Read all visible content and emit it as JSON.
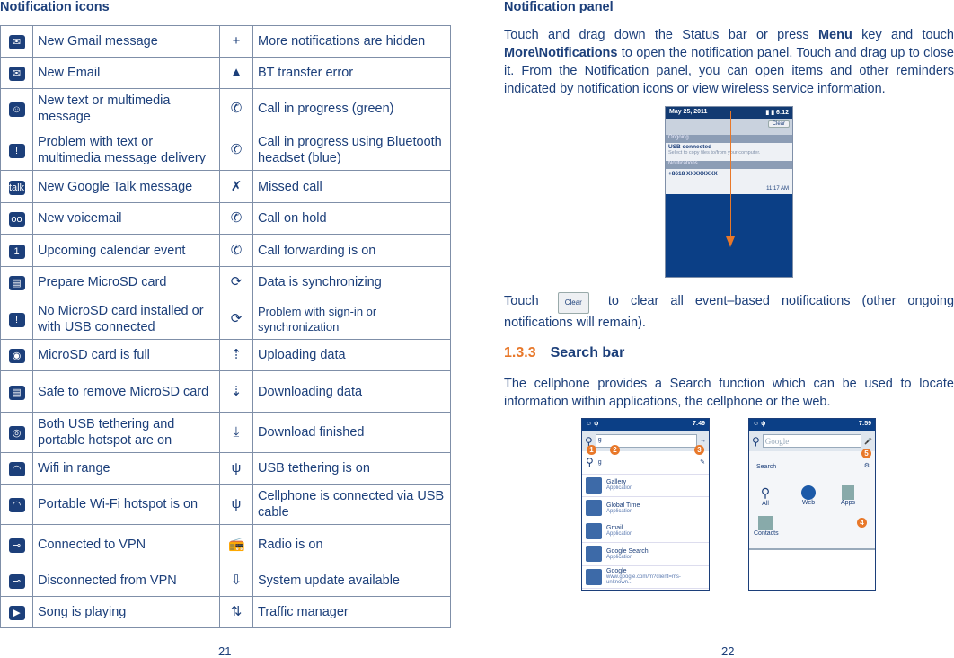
{
  "left": {
    "title": "Notification icons",
    "page_number": "21",
    "rows": [
      {
        "l_icon": "gmail-icon",
        "l_glyph": "✉",
        "l": "New Gmail message",
        "r_icon": "more-hidden-icon",
        "r_glyph": "+",
        "r": "More notifications are hidden"
      },
      {
        "l_icon": "email-icon",
        "l_glyph": "✉",
        "l": "New Email",
        "r_icon": "warning-icon",
        "r_glyph": "▲",
        "r": "BT transfer error"
      },
      {
        "l_icon": "sms-icon",
        "l_glyph": "☺",
        "l": "New text or multimedia message",
        "r_icon": "call-green-icon",
        "r_glyph": "✆",
        "r": "Call in progress (green)"
      },
      {
        "l_icon": "sms-error-icon",
        "l_glyph": "!",
        "l": "Problem with text or multimedia message delivery",
        "r_icon": "call-bluetooth-icon",
        "r_glyph": "✆",
        "r": "Call in progress using Bluetooth headset (blue)"
      },
      {
        "l_icon": "talk-icon",
        "l_glyph": "talk",
        "l": "New Google Talk message",
        "r_icon": "missed-call-icon",
        "r_glyph": "✗",
        "r": "Missed call"
      },
      {
        "l_icon": "voicemail-icon",
        "l_glyph": "oo",
        "l": "New voicemail",
        "r_icon": "call-hold-icon",
        "r_glyph": "✆",
        "r": "Call on hold"
      },
      {
        "l_icon": "calendar-icon",
        "l_glyph": "1",
        "l": "Upcoming calendar event",
        "r_icon": "call-forward-icon",
        "r_glyph": "✆",
        "r": "Call forwarding is on"
      },
      {
        "l_icon": "sdcard-prepare-icon",
        "l_glyph": "▤",
        "l": "Prepare MicroSD card",
        "r_icon": "sync-icon",
        "r_glyph": "⟳",
        "r": "Data is synchronizing"
      },
      {
        "l_icon": "sdcard-missing-icon",
        "l_glyph": "!",
        "l": "No MicroSD card installed or with USB connected",
        "r_icon": "sync-error-icon",
        "r_glyph": "⟳",
        "r": "Problem with sign-in or synchronization",
        "r_small": true
      },
      {
        "l_icon": "sdcard-full-icon",
        "l_glyph": "◉",
        "l": "MicroSD card is full",
        "r_icon": "upload-icon",
        "r_glyph": "⇡",
        "r": "Uploading data"
      },
      {
        "l_icon": "sdcard-safe-icon",
        "l_glyph": "▤",
        "l": "Safe to remove MicroSD card",
        "r_icon": "download-icon",
        "r_glyph": "⇣",
        "r": "Downloading data"
      },
      {
        "l_icon": "tether-hotspot-icon",
        "l_glyph": "◎",
        "l": "Both USB tethering and portable hotspot are on",
        "r_icon": "download-done-icon",
        "r_glyph": "⤓",
        "r": "Download finished"
      },
      {
        "l_icon": "wifi-icon",
        "l_glyph": "◠",
        "l": "Wifi in range",
        "r_icon": "usb-tether-icon",
        "r_glyph": "ψ",
        "r": "USB tethering is on"
      },
      {
        "l_icon": "hotspot-icon",
        "l_glyph": "◠",
        "l": "Portable Wi-Fi hotspot is on",
        "r_icon": "usb-icon",
        "r_glyph": "ψ",
        "r": "Cellphone is connected via USB cable"
      },
      {
        "l_icon": "vpn-connected-icon",
        "l_glyph": "⊸",
        "l": "Connected to VPN",
        "r_icon": "radio-icon",
        "r_glyph": "📻",
        "r": "Radio is on"
      },
      {
        "l_icon": "vpn-disconnected-icon",
        "l_glyph": "⊸",
        "l": " Disconnected from VPN",
        "r_icon": "system-update-icon",
        "r_glyph": "⇩",
        "r": "System update available"
      },
      {
        "l_icon": "song-playing-icon",
        "l_glyph": "▶",
        "l": "Song is playing",
        "r_icon": "traffic-manager-icon",
        "r_glyph": "⇅",
        "r": "Traffic manager"
      }
    ]
  },
  "right": {
    "title": "Notification panel",
    "page_number": "22",
    "p1_a": "Touch and drag down the Status bar or press ",
    "p1_menu": "Menu",
    "p1_b": " key and touch ",
    "p1_more": "More\\Notifications",
    "p1_c": " to open the notification panel. Touch and drag up to close it. From the Notification panel, you can open items and other reminders indicated by notification icons or view wireless service information.",
    "p2_a": "Touch",
    "p2_btn": "Clear",
    "p2_b": "to clear all event–based notifications (other ongoing notifications will remain).",
    "section_num": "1.3.3",
    "section_title": "Search bar",
    "p3": "The cellphone provides a Search function which can be used to locate information within applications, the cellphone or the web.",
    "panel_shot": {
      "date": "May 25, 2011",
      "time": "6:12",
      "clear": "Clear",
      "ongoing": "Ongoing",
      "usb_title": "USB connected",
      "usb_sub": "Select to copy files to/from your computer.",
      "notifications": "Notifications",
      "msg": "+8618 XXXXXXXX",
      "msg_time": "11:17 AM"
    },
    "search_shot1": {
      "time": "7:49",
      "query": "g",
      "suggest": "g",
      "items": [
        {
          "t": "Gallery",
          "s": "Application"
        },
        {
          "t": "Global Time",
          "s": "Application"
        },
        {
          "t": "Gmail",
          "s": "Application"
        },
        {
          "t": "Google Search",
          "s": "Application"
        },
        {
          "t": "Google",
          "s": "www.google.com/m?client=ms-unknown..."
        }
      ],
      "badges": [
        "1",
        "2",
        "3"
      ]
    },
    "search_shot2": {
      "time": "7:59",
      "placeholder": "Google",
      "search_label": "Search",
      "targets": [
        "All",
        "Web",
        "Apps",
        "Contacts"
      ],
      "badges": [
        "4",
        "5"
      ]
    }
  }
}
